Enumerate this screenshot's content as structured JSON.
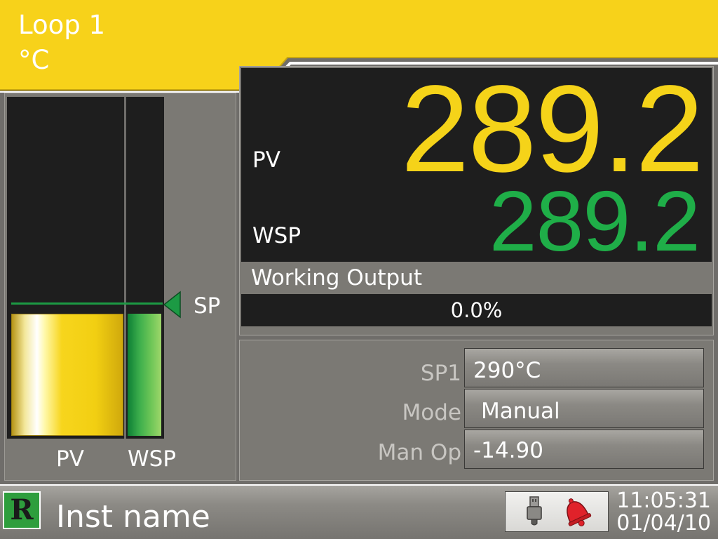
{
  "header": {
    "title": "Loop 1",
    "units": "°C"
  },
  "bargraph": {
    "sp_label": "SP",
    "pv_label": "PV",
    "wsp_label": "WSP",
    "pv_fill_fraction": 0.36,
    "wsp_fill_fraction": 0.36,
    "sp_marker_fraction": 0.4
  },
  "values": {
    "pv_label": "PV",
    "pv_value": "289.2",
    "wsp_label": "WSP",
    "wsp_value": "289.2"
  },
  "output": {
    "title": "Working Output",
    "value": "0.0%"
  },
  "params": {
    "sp1_label": "SP1",
    "sp1_value": "290°C",
    "mode_label": "Mode",
    "mode_value": "Manual",
    "manop_label": "Man Op",
    "manop_value": "-14.90"
  },
  "footer": {
    "logo_letter": "R",
    "instrument_name": "Inst name",
    "time": "11:05:31",
    "date": "01/04/10",
    "icons": [
      "usb-icon",
      "alarm-bell-icon"
    ]
  },
  "colors": {
    "header": "#f7d21a",
    "pv": "#f5d319",
    "wsp": "#1fae48",
    "panel": "#7b7974",
    "display_black": "#1e1e1e"
  }
}
